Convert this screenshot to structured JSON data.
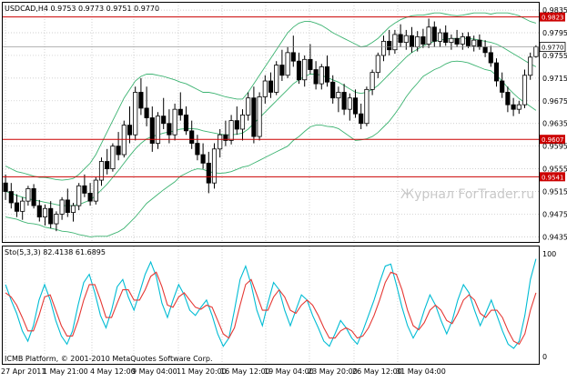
{
  "chart_data": [
    {
      "type": "candlestick",
      "symbol_info": "USDCAD,H4  0.9753 0.9773 0.9751 0.9770",
      "watermark": "Журнал ForTrader.ru",
      "yticks": [
        "0.9835",
        "0.9795",
        "0.9755",
        "0.9715",
        "0.9675",
        "0.9635",
        "0.9595",
        "0.9555",
        "0.9515",
        "0.9475",
        "0.9435"
      ],
      "ylim": [
        0.9426,
        0.9848
      ],
      "current_price": "0.9770",
      "levels": [
        {
          "value": 0.9823,
          "label": "0.9823"
        },
        {
          "value": 0.9607,
          "label": "0.9607"
        },
        {
          "value": 0.9541,
          "label": "0.9541"
        }
      ],
      "overlays": [
        "Bollinger Bands"
      ],
      "colors": {
        "candle": "#000000",
        "bands": "#3cb371",
        "levels": "#cc0000",
        "grid": "#c0c0c0",
        "tag": "#cc0000"
      },
      "grid": true,
      "ohlc": [
        [
          0.953,
          0.9545,
          0.95,
          0.9515
        ],
        [
          0.9515,
          0.953,
          0.9485,
          0.9495
        ],
        [
          0.9495,
          0.951,
          0.947,
          0.948
        ],
        [
          0.948,
          0.9505,
          0.9465,
          0.9498
        ],
        [
          0.9498,
          0.9525,
          0.949,
          0.952
        ],
        [
          0.952,
          0.9528,
          0.9485,
          0.949
        ],
        [
          0.949,
          0.95,
          0.9462,
          0.947
        ],
        [
          0.947,
          0.9492,
          0.9455,
          0.9485
        ],
        [
          0.9485,
          0.9498,
          0.945,
          0.9458
        ],
        [
          0.9458,
          0.948,
          0.9445,
          0.9475
        ],
        [
          0.9475,
          0.9505,
          0.9465,
          0.95
        ],
        [
          0.95,
          0.952,
          0.947,
          0.9478
        ],
        [
          0.9478,
          0.9495,
          0.9462,
          0.949
        ],
        [
          0.949,
          0.953,
          0.9482,
          0.9525
        ],
        [
          0.9525,
          0.9545,
          0.9505,
          0.9512
        ],
        [
          0.9512,
          0.953,
          0.949,
          0.9498
        ],
        [
          0.9498,
          0.954,
          0.9492,
          0.9535
        ],
        [
          0.9535,
          0.9575,
          0.9525,
          0.9568
        ],
        [
          0.9568,
          0.959,
          0.9545,
          0.9555
        ],
        [
          0.9555,
          0.96,
          0.955,
          0.9595
        ],
        [
          0.9595,
          0.962,
          0.957,
          0.958
        ],
        [
          0.958,
          0.964,
          0.9575,
          0.9632
        ],
        [
          0.9632,
          0.9665,
          0.96,
          0.9615
        ],
        [
          0.9615,
          0.97,
          0.9605,
          0.969
        ],
        [
          0.969,
          0.9715,
          0.965,
          0.9662
        ],
        [
          0.9662,
          0.97,
          0.963,
          0.9645
        ],
        [
          0.9645,
          0.9665,
          0.9585,
          0.96
        ],
        [
          0.96,
          0.9655,
          0.959,
          0.9648
        ],
        [
          0.9648,
          0.968,
          0.9625,
          0.9635
        ],
        [
          0.9635,
          0.966,
          0.96,
          0.9615
        ],
        [
          0.9615,
          0.967,
          0.9605,
          0.966
        ],
        [
          0.966,
          0.969,
          0.964,
          0.965
        ],
        [
          0.965,
          0.9665,
          0.9615,
          0.9622
        ],
        [
          0.9622,
          0.964,
          0.959,
          0.96
        ],
        [
          0.96,
          0.9615,
          0.957,
          0.958
        ],
        [
          0.958,
          0.96,
          0.9555,
          0.9565
        ],
        [
          0.9565,
          0.9585,
          0.9512,
          0.953
        ],
        [
          0.953,
          0.96,
          0.952,
          0.959
        ],
        [
          0.959,
          0.9625,
          0.9575,
          0.9615
        ],
        [
          0.9615,
          0.964,
          0.9595,
          0.9605
        ],
        [
          0.9605,
          0.965,
          0.9598,
          0.964
        ],
        [
          0.964,
          0.9665,
          0.9615,
          0.9625
        ],
        [
          0.9625,
          0.966,
          0.9605,
          0.965
        ],
        [
          0.965,
          0.969,
          0.964,
          0.968
        ],
        [
          0.968,
          0.97,
          0.96,
          0.9612
        ],
        [
          0.9612,
          0.969,
          0.9605,
          0.9682
        ],
        [
          0.9682,
          0.972,
          0.967,
          0.971
        ],
        [
          0.971,
          0.9725,
          0.968,
          0.969
        ],
        [
          0.969,
          0.9745,
          0.9685,
          0.9738
        ],
        [
          0.9738,
          0.9765,
          0.971,
          0.972
        ],
        [
          0.972,
          0.977,
          0.9715,
          0.976
        ],
        [
          0.976,
          0.979,
          0.9735,
          0.9745
        ],
        [
          0.9745,
          0.976,
          0.9705,
          0.9712
        ],
        [
          0.9712,
          0.9755,
          0.97,
          0.9748
        ],
        [
          0.9748,
          0.9775,
          0.9722,
          0.973
        ],
        [
          0.973,
          0.9745,
          0.9695,
          0.9705
        ],
        [
          0.9705,
          0.974,
          0.9695,
          0.9735
        ],
        [
          0.9735,
          0.9755,
          0.97,
          0.9708
        ],
        [
          0.9708,
          0.972,
          0.967,
          0.968
        ],
        [
          0.968,
          0.97,
          0.9655,
          0.969
        ],
        [
          0.969,
          0.9705,
          0.965,
          0.966
        ],
        [
          0.966,
          0.9688,
          0.964,
          0.968
        ],
        [
          0.968,
          0.9695,
          0.9645,
          0.9652
        ],
        [
          0.9652,
          0.967,
          0.9625,
          0.9635
        ],
        [
          0.9635,
          0.97,
          0.963,
          0.9695
        ],
        [
          0.9695,
          0.973,
          0.9685,
          0.9725
        ],
        [
          0.9725,
          0.976,
          0.9715,
          0.9755
        ],
        [
          0.9755,
          0.979,
          0.9745,
          0.978
        ],
        [
          0.978,
          0.98,
          0.9755,
          0.9765
        ],
        [
          0.9765,
          0.98,
          0.9758,
          0.9792
        ],
        [
          0.9792,
          0.981,
          0.977,
          0.9778
        ],
        [
          0.9778,
          0.98,
          0.9765,
          0.979
        ],
        [
          0.979,
          0.9805,
          0.976,
          0.977
        ],
        [
          0.977,
          0.9798,
          0.9762,
          0.9788
        ],
        [
          0.9788,
          0.9802,
          0.9768,
          0.9775
        ],
        [
          0.9775,
          0.982,
          0.9768,
          0.9805
        ],
        [
          0.9805,
          0.9815,
          0.977,
          0.978
        ],
        [
          0.978,
          0.9802,
          0.977,
          0.9795
        ],
        [
          0.9795,
          0.9808,
          0.9772,
          0.9778
        ],
        [
          0.9778,
          0.9792,
          0.9765,
          0.9785
        ],
        [
          0.9785,
          0.98,
          0.977,
          0.9775
        ],
        [
          0.9775,
          0.9795,
          0.9765,
          0.9788
        ],
        [
          0.9788,
          0.9796,
          0.9768,
          0.9772
        ],
        [
          0.9772,
          0.979,
          0.9762,
          0.9782
        ],
        [
          0.9782,
          0.9792,
          0.9765,
          0.977
        ],
        [
          0.977,
          0.9782,
          0.9752,
          0.976
        ],
        [
          0.976,
          0.9772,
          0.9735,
          0.9742
        ],
        [
          0.9742,
          0.975,
          0.97,
          0.971
        ],
        [
          0.971,
          0.9725,
          0.968,
          0.969
        ],
        [
          0.969,
          0.97,
          0.9655,
          0.9668
        ],
        [
          0.9668,
          0.968,
          0.9648,
          0.966
        ],
        [
          0.966,
          0.9675,
          0.9652,
          0.9668
        ],
        [
          0.9668,
          0.973,
          0.9662,
          0.972
        ],
        [
          0.972,
          0.976,
          0.9712,
          0.9752
        ],
        [
          0.9753,
          0.9773,
          0.9751,
          0.977
        ]
      ],
      "bollinger": {
        "upper": [
          0.956,
          0.9555,
          0.955,
          0.9548,
          0.9545,
          0.9542,
          0.954,
          0.954,
          0.9538,
          0.9536,
          0.9535,
          0.9536,
          0.9538,
          0.9545,
          0.9555,
          0.9565,
          0.958,
          0.96,
          0.962,
          0.964,
          0.966,
          0.968,
          0.9695,
          0.971,
          0.9718,
          0.9722,
          0.9722,
          0.972,
          0.9718,
          0.9715,
          0.9712,
          0.9708,
          0.9705,
          0.97,
          0.9695,
          0.969,
          0.969,
          0.9688,
          0.9685,
          0.9682,
          0.968,
          0.9678,
          0.9678,
          0.969,
          0.9705,
          0.972,
          0.9735,
          0.975,
          0.9765,
          0.978,
          0.9795,
          0.9805,
          0.9812,
          0.9815,
          0.9815,
          0.9812,
          0.9808,
          0.9802,
          0.9795,
          0.979,
          0.9785,
          0.978,
          0.9775,
          0.977,
          0.9772,
          0.9778,
          0.9785,
          0.9795,
          0.9805,
          0.9812,
          0.9818,
          0.9822,
          0.9825,
          0.9826,
          0.9826,
          0.9828,
          0.983,
          0.983,
          0.9828,
          0.9826,
          0.9825,
          0.9826,
          0.9828,
          0.983,
          0.983,
          0.983,
          0.9828,
          0.983,
          0.983,
          0.983,
          0.9828,
          0.9825,
          0.982,
          0.9815,
          0.9812
        ],
        "middle": [
          0.9515,
          0.9512,
          0.9508,
          0.9505,
          0.9502,
          0.95,
          0.9498,
          0.9496,
          0.9494,
          0.9492,
          0.949,
          0.949,
          0.949,
          0.9492,
          0.9496,
          0.95,
          0.9508,
          0.9518,
          0.9528,
          0.954,
          0.9552,
          0.9565,
          0.9578,
          0.959,
          0.96,
          0.9608,
          0.9612,
          0.9615,
          0.9618,
          0.962,
          0.9622,
          0.9625,
          0.9626,
          0.9626,
          0.9625,
          0.9622,
          0.962,
          0.9618,
          0.9616,
          0.9615,
          0.9615,
          0.9616,
          0.9618,
          0.9625,
          0.9635,
          0.9645,
          0.9655,
          0.9665,
          0.9675,
          0.9685,
          0.9695,
          0.9705,
          0.9712,
          0.9718,
          0.9722,
          0.9722,
          0.972,
          0.9716,
          0.9712,
          0.9708,
          0.9702,
          0.9696,
          0.969,
          0.9688,
          0.969,
          0.9695,
          0.9702,
          0.9712,
          0.9722,
          0.9732,
          0.9742,
          0.9752,
          0.976,
          0.9766,
          0.9772,
          0.9776,
          0.978,
          0.9782,
          0.9784,
          0.9785,
          0.9785,
          0.9785,
          0.9785,
          0.9784,
          0.9782,
          0.978,
          0.9778,
          0.9775,
          0.977,
          0.9764,
          0.9758,
          0.9752,
          0.9746,
          0.974,
          0.9735
        ],
        "lower": [
          0.947,
          0.9468,
          0.9466,
          0.9462,
          0.9459,
          0.9458,
          0.9456,
          0.9452,
          0.945,
          0.9448,
          0.9445,
          0.9444,
          0.9442,
          0.9439,
          0.9437,
          0.9435,
          0.9436,
          0.9436,
          0.9436,
          0.944,
          0.9444,
          0.945,
          0.946,
          0.947,
          0.9482,
          0.9494,
          0.9502,
          0.951,
          0.9518,
          0.9525,
          0.9532,
          0.9542,
          0.9547,
          0.9552,
          0.9555,
          0.9554,
          0.955,
          0.9548,
          0.9547,
          0.9548,
          0.955,
          0.9554,
          0.9558,
          0.956,
          0.9565,
          0.957,
          0.9575,
          0.958,
          0.9585,
          0.959,
          0.9595,
          0.9605,
          0.9612,
          0.9621,
          0.9629,
          0.9632,
          0.9632,
          0.963,
          0.9629,
          0.9626,
          0.9619,
          0.9612,
          0.9605,
          0.9606,
          0.9608,
          0.9612,
          0.9619,
          0.9629,
          0.9639,
          0.9652,
          0.9666,
          0.9682,
          0.9695,
          0.9706,
          0.9718,
          0.9724,
          0.973,
          0.9734,
          0.974,
          0.9744,
          0.9745,
          0.9744,
          0.9742,
          0.9738,
          0.9734,
          0.973,
          0.9728,
          0.972,
          0.971,
          0.9698,
          0.9688,
          0.9679,
          0.9672,
          0.9665,
          0.9658
        ]
      }
    },
    {
      "type": "line",
      "title": "Sto(5,3,3) 82.4138 61.6895",
      "yticks": [
        "100",
        "0"
      ],
      "ylim": [
        0,
        100
      ],
      "footer": "ICMB Platform, © 2001-2010 MetaQuotes Software Corp.",
      "series": [
        {
          "color": "#00bcd4",
          "values": [
            70,
            55,
            42,
            25,
            15,
            30,
            55,
            70,
            55,
            35,
            20,
            12,
            25,
            50,
            72,
            80,
            62,
            40,
            28,
            45,
            68,
            75,
            58,
            45,
            62,
            80,
            92,
            78,
            52,
            38,
            55,
            70,
            60,
            45,
            40,
            48,
            55,
            40,
            22,
            10,
            18,
            45,
            75,
            88,
            70,
            45,
            30,
            52,
            72,
            65,
            45,
            30,
            45,
            60,
            55,
            40,
            28,
            15,
            10,
            22,
            35,
            28,
            18,
            12,
            25,
            40,
            55,
            72,
            88,
            90,
            70,
            48,
            30,
            18,
            28,
            45,
            60,
            50,
            35,
            22,
            35,
            55,
            70,
            62,
            45,
            30,
            42,
            55,
            40,
            25,
            12,
            8,
            15,
            40,
            75,
            95
          ]
        },
        {
          "color": "#e53935",
          "values": [
            62,
            58,
            50,
            38,
            25,
            25,
            40,
            58,
            60,
            45,
            30,
            20,
            20,
            35,
            55,
            70,
            70,
            55,
            38,
            38,
            52,
            65,
            65,
            55,
            55,
            65,
            78,
            82,
            68,
            50,
            48,
            58,
            62,
            55,
            48,
            46,
            50,
            48,
            35,
            22,
            18,
            28,
            50,
            70,
            75,
            60,
            45,
            45,
            58,
            65,
            58,
            45,
            42,
            50,
            55,
            50,
            40,
            28,
            18,
            18,
            25,
            28,
            25,
            18,
            20,
            28,
            40,
            55,
            72,
            82,
            80,
            65,
            45,
            30,
            26,
            33,
            45,
            50,
            45,
            35,
            32,
            42,
            55,
            60,
            55,
            42,
            38,
            45,
            45,
            38,
            25,
            15,
            12,
            22,
            45,
            62
          ]
        }
      ]
    }
  ],
  "xticks": [
    "27 Apr 2011",
    "1 May 21:00",
    "4 May 12:00",
    "9 May 04:00",
    "11 May 20:00",
    "16 May 12:00",
    "19 May 04:00",
    "23 May 20:00",
    "26 May 12:00",
    "31 May 04:00"
  ]
}
